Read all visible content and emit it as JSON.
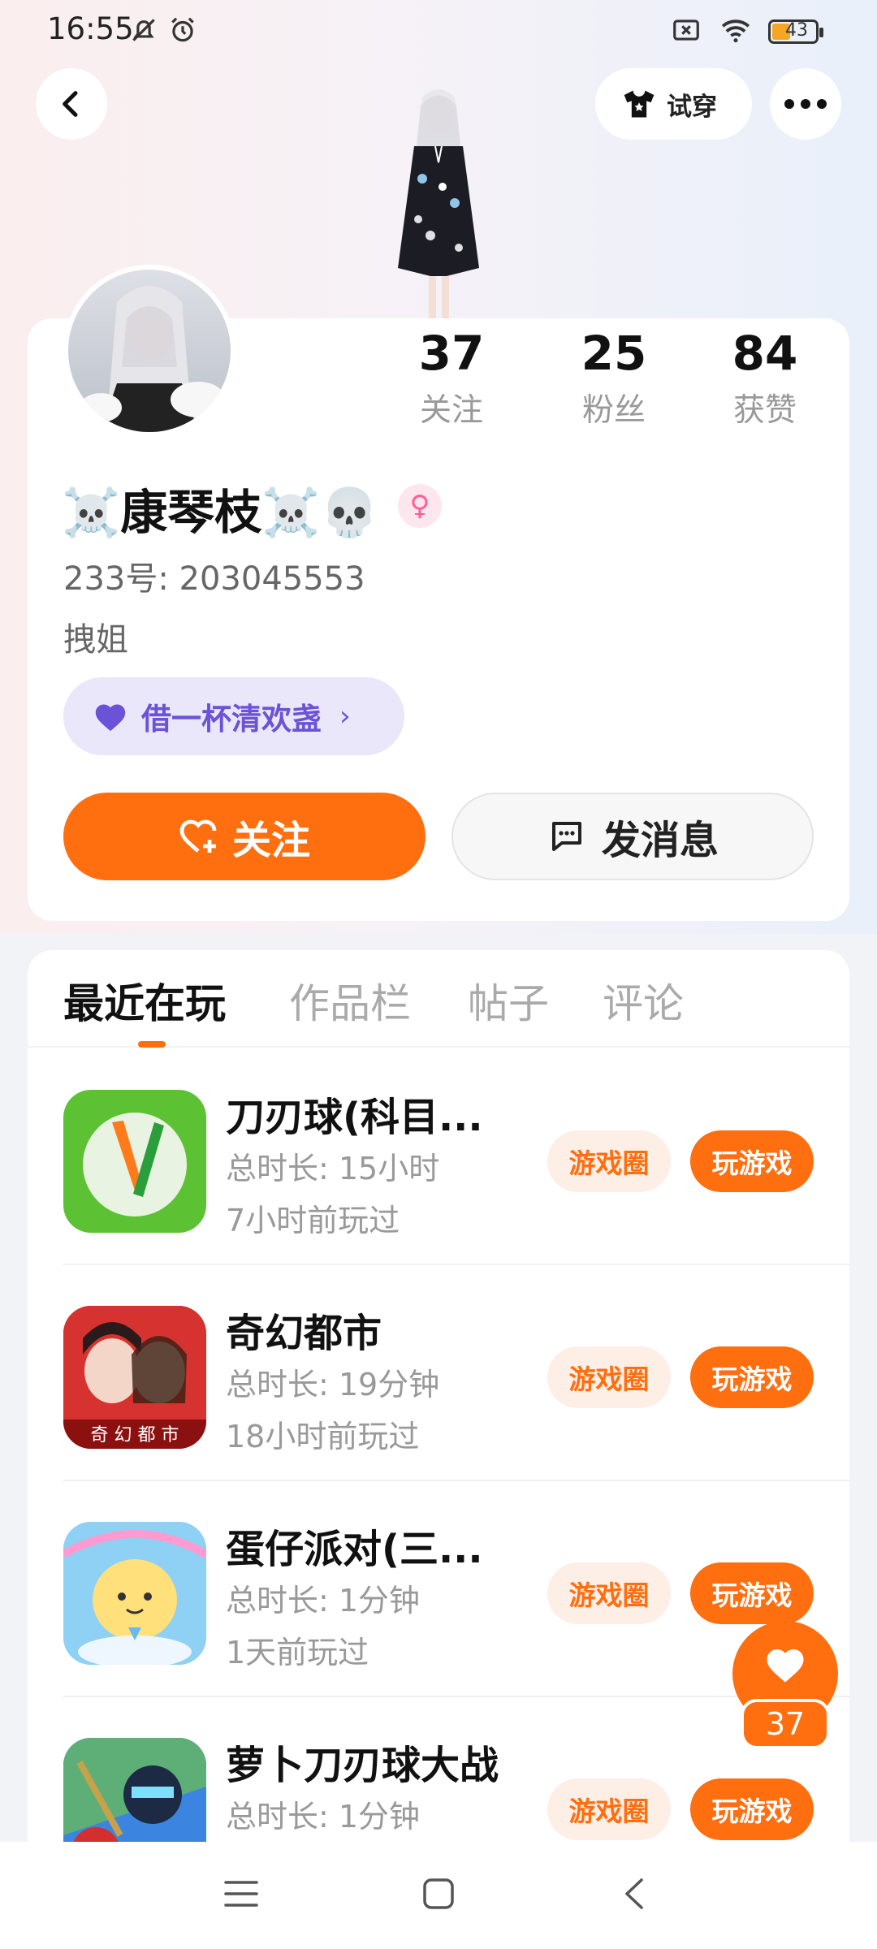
{
  "status_bar": {
    "time": "16:55",
    "battery": "43",
    "icons": [
      "bell-off-icon",
      "alarm-icon",
      "sim-x-icon",
      "wifi-icon",
      "battery-icon"
    ]
  },
  "header": {
    "back_icon": "chevron-left-icon",
    "tryon_label": "试穿",
    "more_icon": "more-dots-icon"
  },
  "profile": {
    "name": "☠️康琴枝☠️💀",
    "gender_symbol": "♀",
    "uid": "233号: 203045553",
    "bio": "拽姐",
    "tag_label": "借一杯清欢盏",
    "tag_arrow": "›",
    "stats": [
      {
        "num": "37",
        "label": "关注"
      },
      {
        "num": "25",
        "label": "粉丝"
      },
      {
        "num": "84",
        "label": "获赞"
      }
    ],
    "follow_label": "关注",
    "message_label": "发消息"
  },
  "tabs": [
    "最近在玩",
    "作品栏",
    "帖子",
    "评论"
  ],
  "games": [
    {
      "name": "刀刃球(科目...",
      "duration": "总时长: 15小时",
      "last": "7小时前玩过",
      "circle": "游戏圈",
      "play": "玩游戏"
    },
    {
      "name": "奇幻都市",
      "duration": "总时长: 19分钟",
      "last": "18小时前玩过",
      "circle": "游戏圈",
      "play": "玩游戏"
    },
    {
      "name": "蛋仔派对(三...",
      "duration": "总时长: 1分钟",
      "last": "1天前玩过",
      "circle": "游戏圈",
      "play": "玩游戏"
    },
    {
      "name": "萝卜刀刃球大战",
      "duration": "总时长: 1分钟",
      "last": "",
      "circle": "游戏圈",
      "play": "玩游戏"
    }
  ],
  "like_fab": {
    "count": "37"
  },
  "colors": {
    "accent": "#ff6e0f",
    "tag": "#6b52d6"
  }
}
